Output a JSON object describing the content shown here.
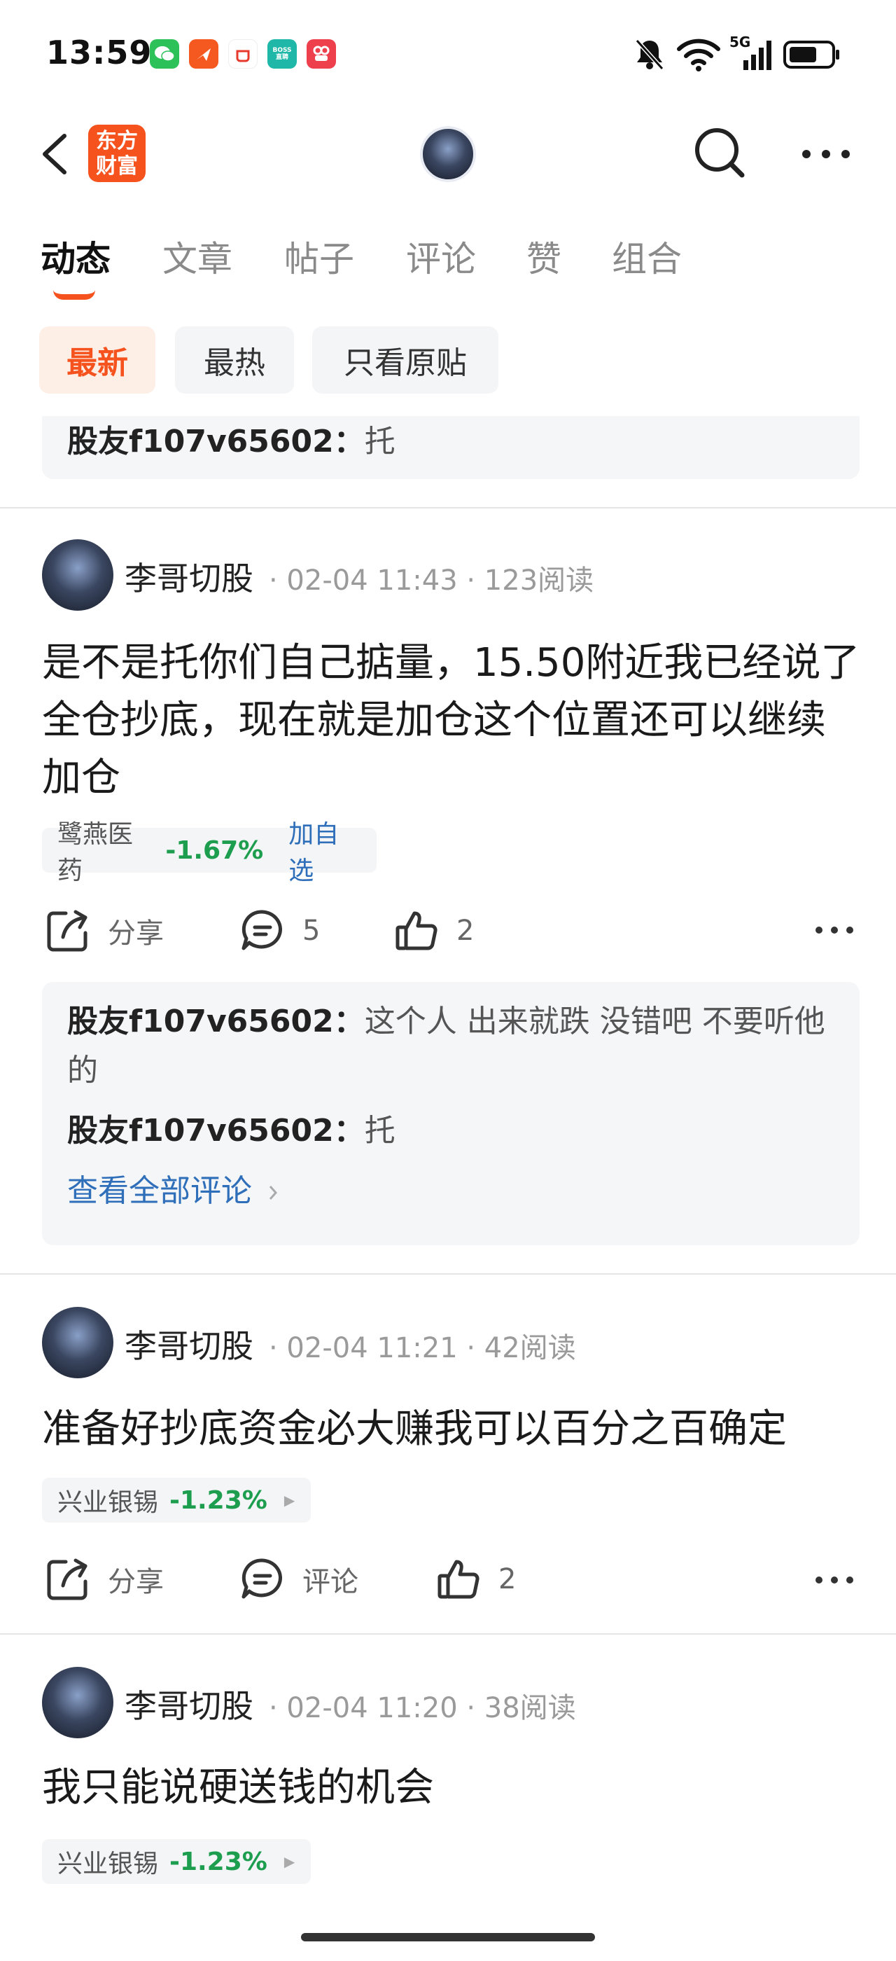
{
  "status_bar": {
    "time": "13:59",
    "network": "5G",
    "app_icons": [
      "wechat-icon",
      "feishu-icon",
      "shopping-icon",
      "boss-zhipin-icon",
      "ticket-icon"
    ],
    "boss_label": "BOSS\n直聘"
  },
  "nav": {
    "brand_logo_text": "东方\n财富",
    "icons": [
      "back-icon",
      "search-icon",
      "more-icon"
    ]
  },
  "tabs": [
    {
      "label": "动态",
      "active": true
    },
    {
      "label": "文章",
      "active": false
    },
    {
      "label": "帖子",
      "active": false
    },
    {
      "label": "评论",
      "active": false
    },
    {
      "label": "赞",
      "active": false
    },
    {
      "label": "组合",
      "active": false
    }
  ],
  "filters": [
    {
      "label": "最新",
      "active": true
    },
    {
      "label": "最热",
      "active": false
    },
    {
      "label": "只看原贴",
      "active": false
    }
  ],
  "top_comment": {
    "user": "股友f107v65602：",
    "text": "托"
  },
  "posts": [
    {
      "author": "李哥切股",
      "meta": "· 02-04 11:43 · 123阅读",
      "text": "是不是托你们自己掂量，15.50附近我已经说了全仓抄底，现在就是加仓这个位置还可以继续加仓",
      "stock_name": "鹭燕医药",
      "stock_change": "-1.67%",
      "add_watch": "加自选",
      "share_label": "分享",
      "comment_label": "5",
      "like_count": "2",
      "comments": [
        {
          "user": "股友f107v65602：",
          "text": "这个人 出来就跌 没错吧 不要听他的"
        },
        {
          "user": "股友f107v65602：",
          "text": "托"
        }
      ],
      "view_all": "查看全部评论"
    },
    {
      "author": "李哥切股",
      "meta": "· 02-04 11:21 · 42阅读",
      "text": "准备好抄底资金必大赚我可以百分之百确定",
      "stock_name": "兴业银锡",
      "stock_change": "-1.23%",
      "share_label": "分享",
      "comment_label": "评论",
      "like_count": "2"
    },
    {
      "author": "李哥切股",
      "meta": "· 02-04 11:20 · 38阅读",
      "text": "我只能说硬送钱的机会",
      "stock_name": "兴业银锡",
      "stock_change": "-1.23%"
    }
  ],
  "colors": {
    "accent": "#f5521e",
    "stock_down": "#1d9e4f",
    "link": "#2f6fba"
  }
}
